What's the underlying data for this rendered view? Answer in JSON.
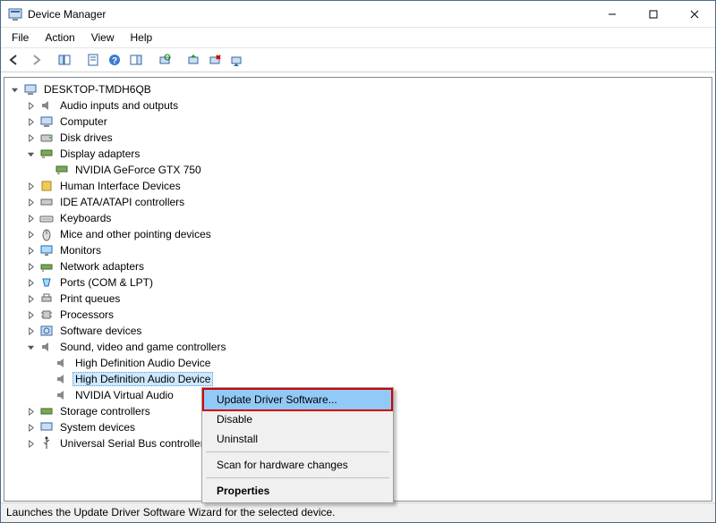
{
  "window": {
    "title": "Device Manager"
  },
  "menubar": {
    "file": "File",
    "action": "Action",
    "view": "View",
    "help": "Help"
  },
  "tree": {
    "root": "DESKTOP-TMDH6QB",
    "audio_io": "Audio inputs and outputs",
    "computer": "Computer",
    "disk_drives": "Disk drives",
    "display_adapters": "Display adapters",
    "gpu0": "NVIDIA GeForce GTX 750",
    "hid": "Human Interface Devices",
    "ide": "IDE ATA/ATAPI controllers",
    "keyboards": "Keyboards",
    "mice": "Mice and other pointing devices",
    "monitors": "Monitors",
    "network": "Network adapters",
    "ports": "Ports (COM & LPT)",
    "print_queues": "Print queues",
    "processors": "Processors",
    "software_devices": "Software devices",
    "sound": "Sound, video and game controllers",
    "snd1": "High Definition Audio Device",
    "snd2": "High Definition Audio Device",
    "snd3": "NVIDIA Virtual Audio",
    "storage": "Storage controllers",
    "system": "System devices",
    "usb": "Universal Serial Bus controllers"
  },
  "context_menu": {
    "update": "Update Driver Software...",
    "disable": "Disable",
    "uninstall": "Uninstall",
    "scan": "Scan for hardware changes",
    "properties": "Properties"
  },
  "statusbar": {
    "text": "Launches the Update Driver Software Wizard for the selected device."
  }
}
